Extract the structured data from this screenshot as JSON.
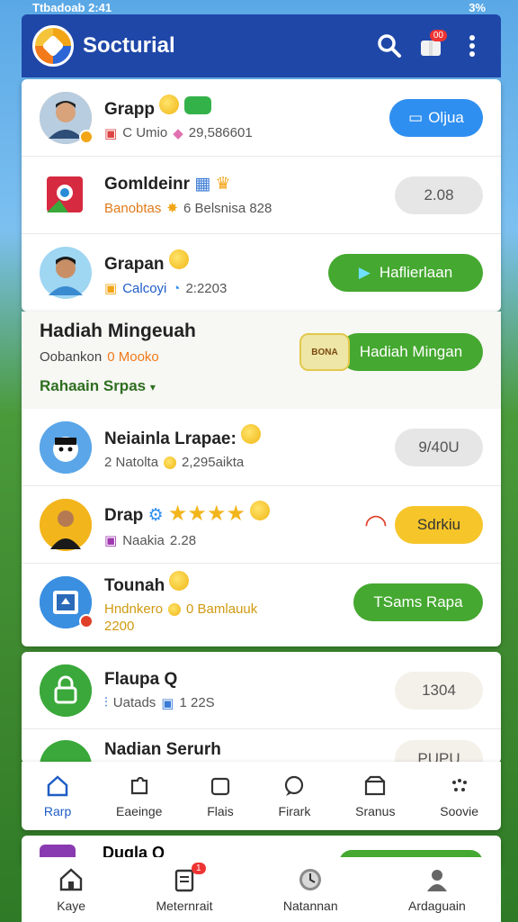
{
  "status": {
    "left": "Ttbadoab",
    "left2": "2:41",
    "right": "3%"
  },
  "header": {
    "title": "Socturial",
    "notification_count": "00"
  },
  "list1": [
    {
      "title": "Grapp",
      "sub": "C Umio",
      "sub2": "29,586601",
      "button": "Oljua",
      "button_style": "blue"
    },
    {
      "title": "Gomldeinr",
      "sub": "Banobtas",
      "sub2": "6 Belsnisa 828",
      "button": "2.08",
      "button_style": "gray"
    },
    {
      "title": "Grapan",
      "sub": "Calcoyi",
      "sub2": "2:2203",
      "button": "Haflierlaan",
      "button_style": "green"
    }
  ],
  "weekly": {
    "title": "Hadiah Mingeuah",
    "sub1": "Oobankon",
    "sub2": "0 Mooko",
    "chest_label": "BONA",
    "button": "Hadiah Mingan",
    "link": "Rahaain Srpas",
    "link_chevron": "▾"
  },
  "list2": [
    {
      "title": "Neiainla Lrapae:",
      "sub": "2 Natolta",
      "sub2": "2,295aikta",
      "button": "9/40U",
      "button_style": "gray"
    },
    {
      "title": "Drap",
      "sub": "Naakia",
      "sub2": "2.28",
      "button": "Sdrkiu",
      "button_style": "yellow"
    },
    {
      "title": "Tounah",
      "sub": "Hndnkero",
      "sub2": "0 Bamlauuk",
      "sub3": "2200",
      "button": "TSams Rapa",
      "button_style": "green"
    }
  ],
  "list3": [
    {
      "title": "Flaupa Q",
      "sub": "Uatads",
      "sub2": "1 22S",
      "button": "1304",
      "button_style": "pale"
    },
    {
      "title": "Nadian Serurh",
      "button": "PUPU",
      "button_style": "pale"
    }
  ],
  "nav_inner": [
    {
      "label": "Rarp",
      "icon": "home-icon",
      "active": true
    },
    {
      "label": "Eaeinge",
      "icon": "puzzle-icon",
      "active": false
    },
    {
      "label": "Flais",
      "icon": "square-icon",
      "active": false
    },
    {
      "label": "Firark",
      "icon": "chat-icon",
      "active": false
    },
    {
      "label": "Sranus",
      "icon": "box-icon",
      "active": false
    },
    {
      "label": "Soovie",
      "icon": "dots-icon",
      "active": false
    }
  ],
  "peek_row": {
    "title": "Duqla Q"
  },
  "nav_bottom": [
    {
      "label": "Kaye",
      "icon": "home-icon"
    },
    {
      "label": "Meternrait",
      "icon": "clipboard-icon",
      "badge": "1"
    },
    {
      "label": "Natannan",
      "icon": "clock-icon"
    },
    {
      "label": "Ardaguain",
      "icon": "user-icon"
    }
  ],
  "colors": {
    "header": "#1f47a8",
    "blue_btn": "#2f8ff0",
    "green_btn": "#45a830",
    "yellow_btn": "#f6c52a"
  }
}
